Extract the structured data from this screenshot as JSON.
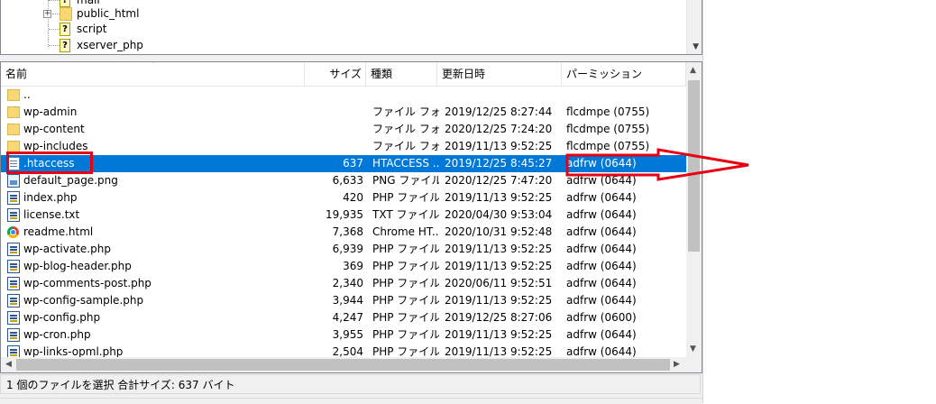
{
  "tree": {
    "items": [
      {
        "label": "mail",
        "icon": "unknown-file-icon"
      },
      {
        "label": "public_html",
        "icon": "folder-icon",
        "expander": "+"
      },
      {
        "label": "script",
        "icon": "unknown-file-icon"
      },
      {
        "label": "xserver_php",
        "icon": "unknown-file-icon"
      }
    ]
  },
  "list": {
    "columns": {
      "name": "名前",
      "size": "サイズ",
      "type": "種類",
      "modified": "更新日時",
      "permissions": "パーミッション"
    },
    "rows": [
      {
        "name": "..",
        "size": "",
        "type": "",
        "modified": "",
        "permissions": "",
        "icon": "folder-icon"
      },
      {
        "name": "wp-admin",
        "size": "",
        "type": "ファイル フォ...",
        "modified": "2019/12/25 8:27:44",
        "permissions": "flcdmpe (0755)",
        "icon": "folder-icon"
      },
      {
        "name": "wp-content",
        "size": "",
        "type": "ファイル フォ...",
        "modified": "2020/12/25 7:24:20",
        "permissions": "flcdmpe (0755)",
        "icon": "folder-icon"
      },
      {
        "name": "wp-includes",
        "size": "",
        "type": "ファイル フォ...",
        "modified": "2019/11/13 9:52:25",
        "permissions": "flcdmpe (0755)",
        "icon": "folder-icon"
      },
      {
        "name": ".htaccess",
        "size": "637",
        "type": "HTACCESS ...",
        "modified": "2019/12/25 8:45:27",
        "permissions": "adfrw (0644)",
        "icon": "text-file-icon",
        "selected": true
      },
      {
        "name": "default_page.png",
        "size": "6,633",
        "type": "PNG ファイル",
        "modified": "2020/12/25 7:47:20",
        "permissions": "adfrw (0644)",
        "icon": "image-file-icon"
      },
      {
        "name": "index.php",
        "size": "420",
        "type": "PHP ファイル",
        "modified": "2019/11/13 9:52:25",
        "permissions": "adfrw (0644)",
        "icon": "php-file-icon"
      },
      {
        "name": "license.txt",
        "size": "19,935",
        "type": "TXT ファイル",
        "modified": "2020/04/30 9:53:04",
        "permissions": "adfrw (0644)",
        "icon": "php-file-icon"
      },
      {
        "name": "readme.html",
        "size": "7,368",
        "type": "Chrome HT...",
        "modified": "2020/10/31 9:52:48",
        "permissions": "adfrw (0644)",
        "icon": "chrome-icon"
      },
      {
        "name": "wp-activate.php",
        "size": "6,939",
        "type": "PHP ファイル",
        "modified": "2019/11/13 9:52:25",
        "permissions": "adfrw (0644)",
        "icon": "php-file-icon"
      },
      {
        "name": "wp-blog-header.php",
        "size": "369",
        "type": "PHP ファイル",
        "modified": "2019/11/13 9:52:25",
        "permissions": "adfrw (0644)",
        "icon": "php-file-icon"
      },
      {
        "name": "wp-comments-post.php",
        "size": "2,340",
        "type": "PHP ファイル",
        "modified": "2020/06/11 9:52:51",
        "permissions": "adfrw (0644)",
        "icon": "php-file-icon"
      },
      {
        "name": "wp-config-sample.php",
        "size": "3,944",
        "type": "PHP ファイル",
        "modified": "2019/11/13 9:52:25",
        "permissions": "adfrw (0644)",
        "icon": "php-file-icon"
      },
      {
        "name": "wp-config.php",
        "size": "4,247",
        "type": "PHP ファイル",
        "modified": "2019/12/25 8:27:06",
        "permissions": "adfrw (0600)",
        "icon": "php-file-icon"
      },
      {
        "name": "wp-cron.php",
        "size": "3,955",
        "type": "PHP ファイル",
        "modified": "2019/11/13 9:52:25",
        "permissions": "adfrw (0644)",
        "icon": "php-file-icon"
      },
      {
        "name": "wp-links-opml.php",
        "size": "2,504",
        "type": "PHP ファイル",
        "modified": "2019/11/13 9:52:25",
        "permissions": "adfrw (0644)",
        "icon": "php-file-icon"
      }
    ]
  },
  "status": {
    "text": "1 個のファイルを選択 合計サイズ: 637 バイト"
  },
  "colors": {
    "selection": "#0078d7",
    "annotation": "#e60012",
    "folder": "#f8d775"
  }
}
